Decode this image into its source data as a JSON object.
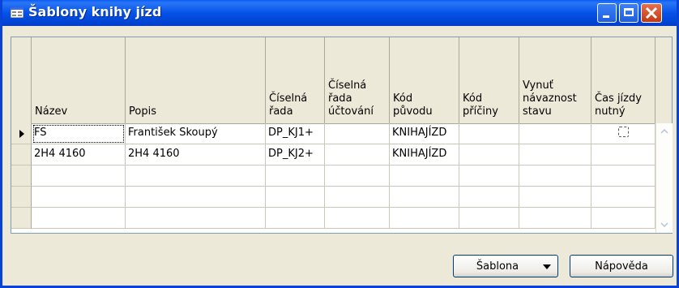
{
  "window": {
    "title": "Šablony knihy jízd",
    "icon": "form-icon",
    "controls": [
      "minimize-icon",
      "maximize-icon",
      "close-icon"
    ]
  },
  "grid": {
    "columns": [
      {
        "key": "nazev",
        "label": "Název"
      },
      {
        "key": "popis",
        "label": "Popis"
      },
      {
        "key": "ciselna_rada",
        "label": "Číselná\nřada"
      },
      {
        "key": "ciselna_rada_uctovani",
        "label": "Číselná\nřada\núčtování"
      },
      {
        "key": "kod_puvodu",
        "label": "Kód\npůvodu"
      },
      {
        "key": "kod_priciny",
        "label": "Kód\npříčiny"
      },
      {
        "key": "vynut_navaznost_stavu",
        "label": "Vynuť\nnávaznost\nstavu"
      },
      {
        "key": "cas_jizdy_nutny",
        "label": "Čas jízdy\nnutný"
      }
    ],
    "rows": [
      {
        "nazev": "FS",
        "popis": "František Skoupý",
        "ciselna_rada": "DP_KJ1+",
        "ciselna_rada_uctovani": "",
        "kod_puvodu": "KNIHAJÍZD",
        "kod_priciny": "",
        "vynut_navaznost_stavu": "",
        "cas_jizdy_nutny": false
      },
      {
        "nazev": "2H4 4160",
        "popis": "2H4 4160",
        "ciselna_rada": "DP_KJ2+",
        "ciselna_rada_uctovani": "",
        "kod_puvodu": "KNIHAJÍZD",
        "kod_priciny": "",
        "vynut_navaznost_stavu": "",
        "cas_jizdy_nutny": null
      }
    ],
    "current_row_indicator": "row-pointer-icon"
  },
  "buttons": {
    "sablona": "Šablona",
    "napoveda": "Nápověda"
  },
  "colors": {
    "titlebar": "#0552e8",
    "window_bg": "#ece9d8",
    "close_button": "#c33914"
  }
}
